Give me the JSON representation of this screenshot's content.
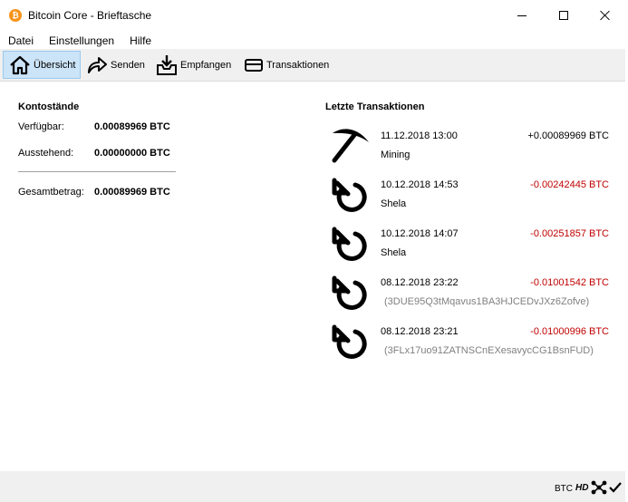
{
  "window": {
    "title": "Bitcoin Core - Brieftasche",
    "app_icon_glyph": "₿",
    "controls": [
      "minimize-icon",
      "maximize-icon",
      "close-icon"
    ]
  },
  "menu": [
    "Datei",
    "Einstellungen",
    "Hilfe"
  ],
  "toolbar": {
    "overview": "Übersicht",
    "send": "Senden",
    "receive": "Empfangen",
    "transactions": "Transaktionen"
  },
  "balances": {
    "title": "Kontostände",
    "available_label": "Verfügbar:",
    "available_value": "0.00089969 BTC",
    "pending_label": "Ausstehend:",
    "pending_value": "0.00000000 BTC",
    "total_label": "Gesamtbetrag:",
    "total_value": "0.00089969 BTC"
  },
  "recent": {
    "title": "Letzte Transaktionen",
    "items": [
      {
        "icon": "mining-pickaxe-icon",
        "date": "11.12.2018 13:00",
        "amount": "+0.00089969 BTC",
        "label": "Mining",
        "negative": false
      },
      {
        "icon": "sent-arrow-icon",
        "date": "10.12.2018 14:53",
        "amount": "-0.00242445 BTC",
        "label": "Shela",
        "negative": true
      },
      {
        "icon": "sent-arrow-icon",
        "date": "10.12.2018 14:07",
        "amount": "-0.00251857 BTC",
        "label": "Shela",
        "negative": true
      },
      {
        "icon": "sent-arrow-icon",
        "date": "08.12.2018 23:22",
        "amount": "-0.01001542 BTC",
        "label": "(3DUE95Q3tMqavus1BA3HJCEDvJXz6Zofve)",
        "negative": true
      },
      {
        "icon": "sent-arrow-icon",
        "date": "08.12.2018 23:21",
        "amount": "-0.01000996 BTC",
        "label": "(3FLx17uo91ZATNSCnEXesavycCG1BsnFUD)",
        "negative": true
      }
    ]
  },
  "status": {
    "unit": "BTC",
    "hd": "HD"
  },
  "colors": {
    "negative_amount": "#c00000",
    "active_tab_bg": "#cce4f7",
    "address_gray": "#808080"
  }
}
